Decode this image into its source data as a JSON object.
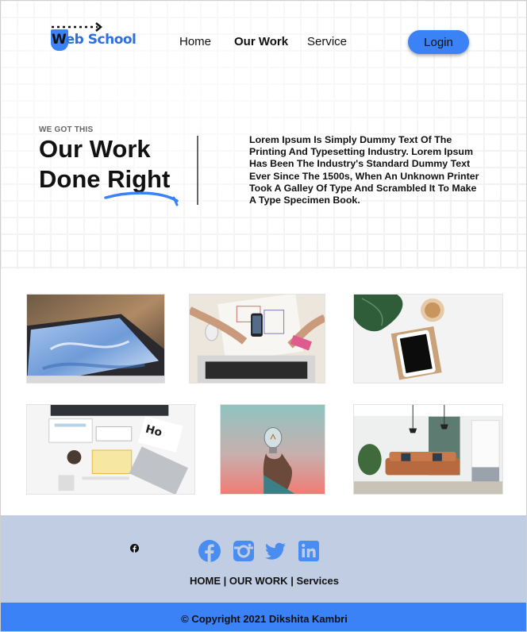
{
  "header": {
    "logo_text_w": "W",
    "logo_text_rest": "eb School",
    "nav": [
      {
        "label": "Home",
        "active": false
      },
      {
        "label": "Our Work",
        "active": true
      },
      {
        "label": "Service",
        "active": false
      }
    ],
    "login_label": "Login"
  },
  "hero": {
    "eyebrow": "WE GOT THIS",
    "headline_line1": "Our Work",
    "headline_line2": "Done Right",
    "description": "Lorem Ipsum Is Simply Dummy Text Of The Printing And Typesetting Industry. Lorem Ipsum Has Been The Industry's Standard Dummy Text Ever Since The 1500s, When An Unknown Printer Took A Galley Of Type And Scrambled It To Make A Type Specimen Book."
  },
  "gallery": [
    {
      "name": "laptop-blue-abstract-photo"
    },
    {
      "name": "desk-sketching-wireframes-photo"
    },
    {
      "name": "tablet-plant-coffee-photo"
    },
    {
      "name": "workspace-topdown-photo"
    },
    {
      "name": "lightbulb-hand-photo"
    },
    {
      "name": "living-room-interior-photo"
    }
  ],
  "footer": {
    "social_icons": [
      "facebook-icon",
      "instagram-icon",
      "twitter-icon",
      "linkedin-icon"
    ],
    "links": [
      "HOME",
      "OUR WORK",
      "Services"
    ],
    "separator": " | ",
    "copyright": "© Copyright 2021 Dikshita Kambri"
  },
  "colors": {
    "accent": "#3b82f6",
    "footer_bg": "#c1cde3",
    "social_icon": "#4a8df0"
  }
}
